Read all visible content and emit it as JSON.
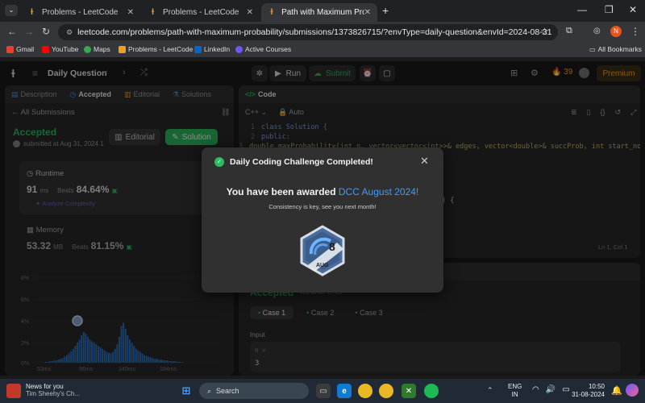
{
  "browser": {
    "tabs": [
      {
        "title": "Problems - LeetCode"
      },
      {
        "title": "Problems - LeetCode"
      },
      {
        "title": "Path with Maximum Probability"
      }
    ],
    "url": "leetcode.com/problems/path-with-maximum-probability/submissions/1373826715/?envType=daily-question&envId=2024-08-31",
    "profile_initial": "N",
    "bookmarks": [
      "Gmail",
      "YouTube",
      "Maps",
      "Problems - LeetCode",
      "LinkedIn",
      "Active Courses"
    ],
    "all_bookmarks": "All Bookmarks"
  },
  "header": {
    "daily": "Daily Question",
    "run": "Run",
    "submit": "Submit",
    "streak": "39",
    "premium": "Premium"
  },
  "left": {
    "tabs": [
      "Description",
      "Accepted",
      "Editorial",
      "Solutions"
    ],
    "all_submissions": "All Submissions",
    "status": "Accepted",
    "submitted": "submitted at Aug 31, 2024 1",
    "editorial_btn": "Editorial",
    "solution_btn": "Solution",
    "runtime_label": "Runtime",
    "runtime_value": "91",
    "runtime_unit": "ms",
    "beats_label": "Beats",
    "runtime_beats": "84.64%",
    "analyze": "Analyze Complexity",
    "memory_label": "Memory",
    "memory_value": "53.32",
    "memory_unit": "MB",
    "memory_beats": "81.15%",
    "chart_y": [
      "8%",
      "6%",
      "4%",
      "2%",
      "0%"
    ],
    "chart_x": [
      "53ms",
      "96ms",
      "140ms",
      "184ms"
    ]
  },
  "code": {
    "tab": "Code",
    "lang": "C++",
    "mode": "Auto",
    "lines": [
      {
        "n": "1",
        "text": "class Solution {"
      },
      {
        "n": "2",
        "text": "public:"
      },
      {
        "n": "3",
        "text": "    double maxProbability(int n, vector<vector<int>>& edges, vector<double>& succProb, int start_node, i"
      }
    ],
    "fragment": ") {",
    "cursor": "Ln 1, Col 1"
  },
  "result": {
    "accepted": "Accepted",
    "runtime": "Runtime: 2 ms",
    "cases": [
      "Case 1",
      "Case 2",
      "Case 3"
    ],
    "input_label": "Input",
    "var": "n =",
    "val": "3"
  },
  "modal": {
    "title": "Daily Coding Challenge Completed!",
    "awarded_prefix": "You have been awarded",
    "award": "DCC August 2024!",
    "subtitle": "Consistency is key, see you next month!",
    "badge_number": "8",
    "badge_month": "AUG"
  },
  "taskbar": {
    "news_title": "News for you",
    "news_sub": "Tim Sheehy's Ch...",
    "search": "Search",
    "lang": "ENG",
    "region": "IN",
    "time": "10:50",
    "date": "31-08-2024"
  },
  "colors": {
    "accent_green": "#2cbb5d",
    "accent_blue": "#3e9cff",
    "bar_blue": "#2f75c6"
  }
}
